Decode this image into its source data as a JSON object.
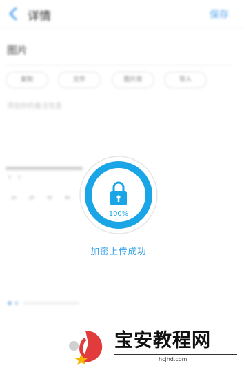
{
  "header": {
    "title": "详情",
    "save_label": "保存"
  },
  "section": {
    "title": "图片"
  },
  "chips": [
    "复制",
    "文件",
    "图片库",
    "导入"
  ],
  "placeholder": "添加你的备注信息",
  "card": {
    "items": [
      "1",
      "1",
      "10",
      "20",
      "30",
      "40"
    ]
  },
  "lock": {
    "percent": "100%",
    "status": "加密上传成功",
    "progress": 1.0
  },
  "watermark": {
    "brand": "宝安教程网",
    "url": "hcjhd.com"
  },
  "colors": {
    "accent": "#1aa6e6",
    "ring_bg": "#eaeaea",
    "brand_red": "#e23b3b"
  }
}
